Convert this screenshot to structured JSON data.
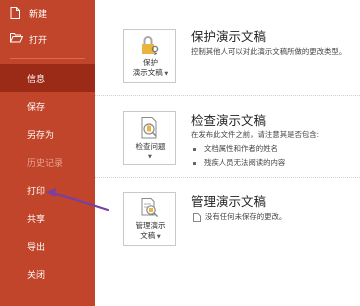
{
  "sidebar": {
    "items": [
      {
        "label": "新建",
        "icon": "new-document-icon"
      },
      {
        "label": "打开",
        "icon": "open-folder-icon"
      },
      {
        "label": "信息"
      },
      {
        "label": "保存"
      },
      {
        "label": "另存为"
      },
      {
        "label": "历史记录"
      },
      {
        "label": "打印"
      },
      {
        "label": "共享"
      },
      {
        "label": "导出"
      },
      {
        "label": "关闭"
      }
    ]
  },
  "sections": {
    "protect": {
      "button_line1": "保护",
      "button_line2": "演示文稿",
      "title": "保护演示文稿",
      "desc": "控制其他人可以对此演示文稿所做的更改类型。",
      "icon": "lock-key-icon"
    },
    "inspect": {
      "button_label": "检查问题",
      "title": "检查演示文稿",
      "desc": "在发布此文件之前，请注意其是否包含:",
      "bullets": [
        "文档属性和作者的姓名",
        "残疾人员无法阅读的内容"
      ],
      "icon": "inspect-document-icon"
    },
    "manage": {
      "button_line1": "管理演示",
      "button_line2": "文稿",
      "title": "管理演示文稿",
      "status": "没有任何未保存的更改。",
      "icon": "manage-versions-icon"
    }
  },
  "colors": {
    "sidebar_bg": "#c1452a",
    "sidebar_selected": "#9b2a16",
    "annotation_arrow": "#7b3fa0"
  }
}
